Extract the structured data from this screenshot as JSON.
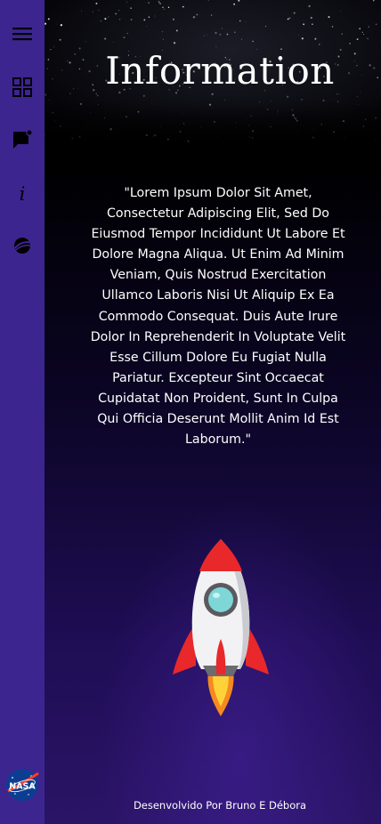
{
  "sidebar": {
    "items": [
      {
        "icon": "menu-icon"
      },
      {
        "icon": "dashboard-grid-icon"
      },
      {
        "icon": "chat-notification-icon"
      },
      {
        "icon": "info-icon",
        "glyph": "i"
      },
      {
        "icon": "planet-icon"
      }
    ],
    "logo": {
      "icon": "nasa-logo",
      "text": "NASA"
    }
  },
  "main": {
    "title": "Information",
    "body": "\"Lorem Ipsum Dolor Sit Amet, Consectetur Adipiscing Elit, Sed Do Eiusmod Tempor Incididunt Ut Labore Et Dolore Magna Aliqua. Ut Enim Ad Minim Veniam, Quis Nostrud Exercitation Ullamco Laboris Nisi Ut Aliquip Ex Ea Commodo Consequat. Duis Aute Irure Dolor In Reprehenderit In Voluptate Velit Esse Cillum Dolore Eu Fugiat Nulla Pariatur. Excepteur Sint Occaecat Cupidatat Non Proident, Sunt In Culpa Qui Officia Deserunt Mollit Anim Id Est Laborum.\"",
    "illustration": "rocket-illustration",
    "footer": "Desenvolvido Por Bruno E Débora"
  },
  "colors": {
    "sidebar_bg": "#3d2590",
    "main_bg_top": "#000000",
    "main_bg_bottom": "#2a1466",
    "text": "#ffffff",
    "rocket_red": "#e8282b",
    "rocket_window": "#7fd6d6"
  }
}
